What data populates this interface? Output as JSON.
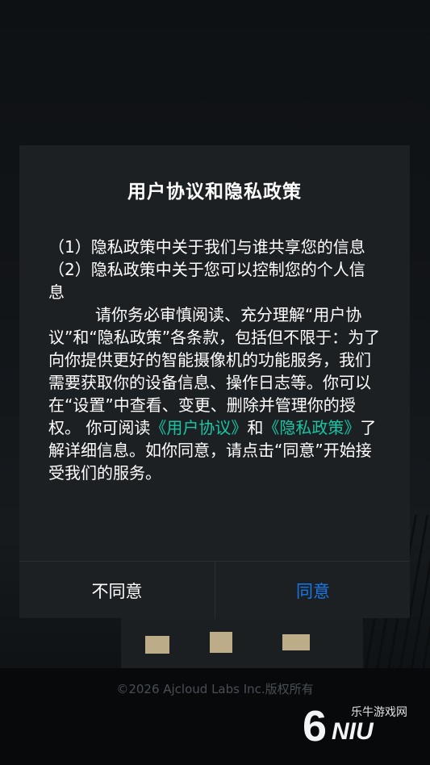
{
  "background": {
    "copyright": "©2026 Ajcloud Labs Inc.版权所有"
  },
  "watermark": {
    "digit": "6",
    "letters": "NIU",
    "text": "乐牛游戏网"
  },
  "dialog": {
    "title": "用户协议和隐私政策",
    "item1": "（1）隐私政策中关于我们与谁共享您的信息",
    "item2": "（2）隐私政策中关于您可以控制您的个人信息",
    "body_part1": "请你务必审慎阅读、充分理解“用户协议”和“隐私政策”各条款，包括但不限于：为了向你提供更好的智能摄像机的功能服务，我们需要获取你的设备信息、操作日志等。你可以在“设置”中查看、变更、删除并管理你的授权。 你可阅读",
    "link_user_agreement": "《用户协议》",
    "body_and": "和",
    "link_privacy_policy": "《隐私政策》",
    "body_part2": "了解详细信息。如你同意，请点击“同意”开始接受我们的服务。",
    "decline_label": "不同意",
    "agree_label": "同意"
  },
  "colors": {
    "dialog_bg": "#1d2023",
    "link": "#18c6a5",
    "agree": "#1877e8"
  }
}
